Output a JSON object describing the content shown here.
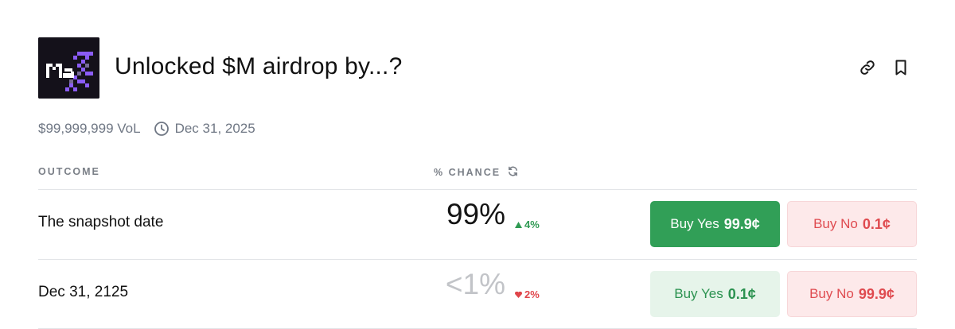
{
  "market": {
    "title": "Unlocked $M airdrop by...?",
    "logo_text": "Max",
    "volume": "$99,999,999 VoL",
    "end_date": "Dec 31, 2025"
  },
  "icons": {
    "link": "link-icon",
    "bookmark": "bookmark-icon",
    "clock": "clock-icon",
    "refresh": "refresh-icon"
  },
  "table": {
    "headers": {
      "outcome": "OUTCOME",
      "chance": "% CHANCE"
    },
    "rows": [
      {
        "label": "The snapshot date",
        "chance": "99%",
        "delta": "4%",
        "delta_direction": "up",
        "buy_yes": {
          "label": "Buy Yes",
          "price": "99.9¢"
        },
        "buy_no": {
          "label": "Buy No",
          "price": "0.1¢"
        }
      },
      {
        "label": "Dec 31, 2125",
        "chance": "<1%",
        "delta": "2%",
        "delta_direction": "down",
        "buy_yes": {
          "label": "Buy Yes",
          "price": "0.1¢"
        },
        "buy_no": {
          "label": "Buy No",
          "price": "99.9¢"
        }
      }
    ]
  },
  "colors": {
    "yes_solid": "#319f57",
    "yes_soft": "#e6f4ea",
    "no_soft": "#fde9ea",
    "up": "#2f9a53",
    "down": "#e0454a",
    "logo_bg": "#14111a",
    "logo_accent": "#8b5cf6"
  }
}
